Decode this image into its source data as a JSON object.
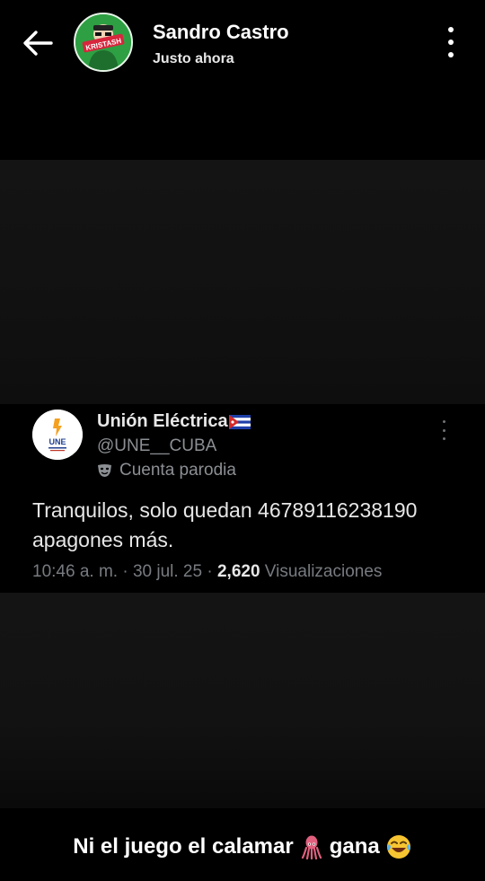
{
  "header": {
    "poster_name": "Sandro Castro",
    "post_time": "Justo ahora",
    "avatar_text": "KRISTASH"
  },
  "tweet": {
    "account_name": "Unión Eléctrica",
    "flag": "cuba-flag",
    "handle": "@UNE__CUBA",
    "label": "Cuenta parodia",
    "avatar_text": "UNE",
    "text": "Tranquilos, solo quedan 46789116238190 apagones más.",
    "time": "10:46 a. m.",
    "date": "30 jul. 25",
    "views_count": "2,620",
    "views_label": "Visualizaciones"
  },
  "caption": {
    "part1": "Ni el juego el calamar",
    "emoji1": "squid-emoji",
    "part2": "gana",
    "emoji2": "laughing-crying-emoji"
  }
}
